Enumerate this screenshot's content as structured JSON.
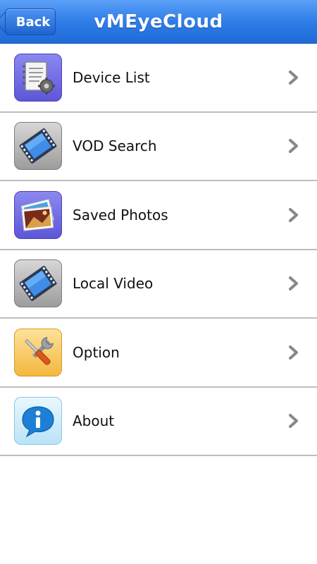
{
  "header": {
    "back_label": "Back",
    "title": "vMEyeCloud",
    "bar_color": "#2f7de8"
  },
  "menu": {
    "items": [
      {
        "label": "Device List",
        "icon": "device-list-icon"
      },
      {
        "label": "VOD Search",
        "icon": "film-icon"
      },
      {
        "label": "Saved Photos",
        "icon": "photos-icon"
      },
      {
        "label": "Local Video",
        "icon": "film-icon"
      },
      {
        "label": "Option",
        "icon": "tools-icon"
      },
      {
        "label": "About",
        "icon": "info-icon"
      }
    ]
  }
}
